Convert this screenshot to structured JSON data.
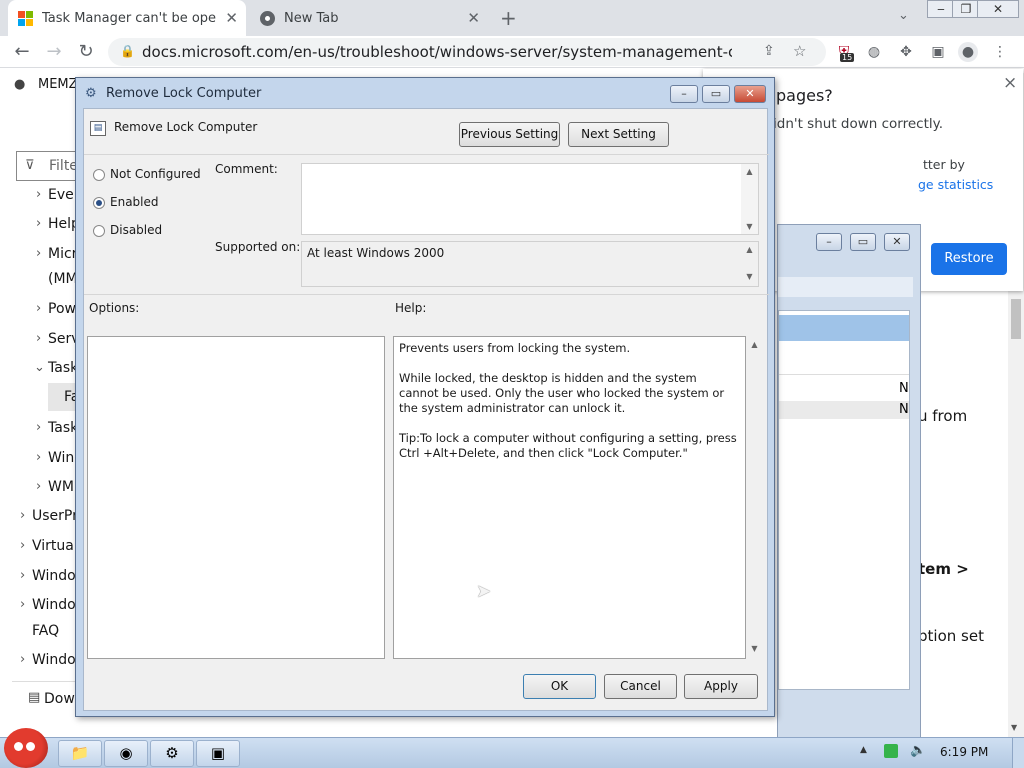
{
  "browser": {
    "tabs": [
      {
        "label": "Task Manager can't be opened",
        "icon": "microsoft-logo",
        "active": true
      },
      {
        "label": "New Tab",
        "icon": "chrome-icon",
        "active": false
      }
    ],
    "new_tab_glyph": "+",
    "url": "docs.microsoft.com/en-us/troubleshoot/windows-server/system-management-compone...",
    "extension_badge": "15"
  },
  "page": {
    "top_label": "MEMZ",
    "filter_placeholder": "Filte",
    "nav_items": [
      "Even",
      "Help",
      "Micr",
      "(MM",
      "Pow",
      "Serv",
      "Task",
      "Fa",
      "Task",
      "Winl",
      "WM",
      "UserPro",
      "Virtuali",
      "Windo",
      "Windo",
      "FAQ",
      "Windo",
      "Dow"
    ],
    "right_text": {
      "from": "u from",
      "item": "tem >",
      "option": "ption set"
    },
    "restore_bubble": {
      "title": "pages?",
      "message": "idn't shut down correctly.",
      "line3": "tter by",
      "link": "ge statistics",
      "button": "Restore",
      "close": "×"
    },
    "bg_window_letters": [
      "N",
      "N"
    ]
  },
  "dialog": {
    "title": "Remove Lock Computer",
    "setting_name": "Remove Lock Computer",
    "previous_button": "Previous Setting",
    "next_button": "Next Setting",
    "radio_options": [
      {
        "label": "Not Configured",
        "selected": false
      },
      {
        "label": "Enabled",
        "selected": true
      },
      {
        "label": "Disabled",
        "selected": false
      }
    ],
    "comment_label": "Comment:",
    "comment_value": "",
    "supported_label": "Supported on:",
    "supported_value": "At least Windows 2000",
    "options_label": "Options:",
    "help_label": "Help:",
    "help_text": "Prevents users from locking the system.\n\nWhile locked, the desktop is hidden and the system cannot be used. Only the user who locked the system or the system administrator can unlock it.\n\nTip:To lock a computer without configuring a setting, press Ctrl +Alt+Delete, and then click \"Lock Computer.\"",
    "ok_button": "OK",
    "cancel_button": "Cancel",
    "apply_button": "Apply"
  },
  "taskbar": {
    "time": "6:19 PM"
  }
}
